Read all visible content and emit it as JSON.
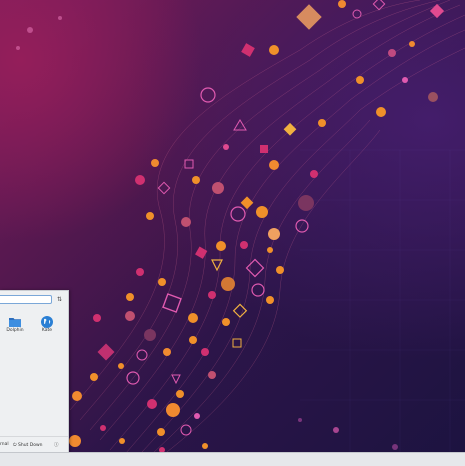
{
  "launcher": {
    "search_placeholder": "",
    "favorites": [
      {
        "label": "Dolphin",
        "icon": "folder-icon",
        "color": "#3d8ee0"
      },
      {
        "label": "Kate",
        "icon": "globe-icon",
        "color": "#2a7fd4"
      }
    ],
    "footer": {
      "left_partial": "rnal",
      "shutdown_label": "Shut Down",
      "power_icon": "power-icon"
    }
  },
  "colors": {
    "wallpaper_magenta": "#7a1d5d",
    "wallpaper_navy": "#1c1340",
    "accent_orange": "#f0902a",
    "accent_pink": "#d8308a",
    "launcher_bg": "#eef0f2",
    "taskbar_bg": "#e6e8eb"
  }
}
